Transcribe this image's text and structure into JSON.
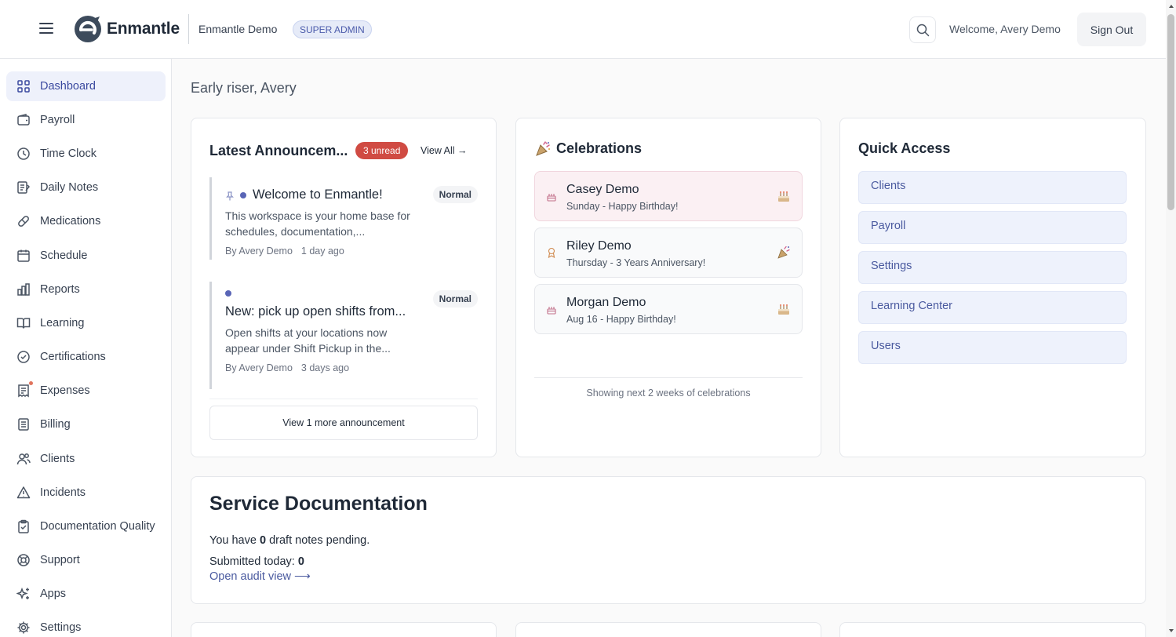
{
  "header": {
    "brand": "Enmantle",
    "org_name": "Enmantle Demo",
    "role_badge": "SUPER ADMIN",
    "welcome": "Welcome, Avery Demo",
    "sign_out": "Sign Out"
  },
  "sidebar": {
    "items": [
      {
        "label": "Dashboard",
        "icon": "grid-icon",
        "active": true
      },
      {
        "label": "Payroll",
        "icon": "wallet-icon"
      },
      {
        "label": "Time Clock",
        "icon": "clock-icon"
      },
      {
        "label": "Daily Notes",
        "icon": "notes-icon"
      },
      {
        "label": "Medications",
        "icon": "pill-icon"
      },
      {
        "label": "Schedule",
        "icon": "calendar-icon"
      },
      {
        "label": "Reports",
        "icon": "bar-chart-icon"
      },
      {
        "label": "Learning",
        "icon": "book-icon"
      },
      {
        "label": "Certifications",
        "icon": "check-circle-icon"
      },
      {
        "label": "Expenses",
        "icon": "receipt-icon"
      },
      {
        "label": "Billing",
        "icon": "document-icon"
      },
      {
        "label": "Clients",
        "icon": "users-icon"
      },
      {
        "label": "Incidents",
        "icon": "alert-icon"
      },
      {
        "label": "Documentation Quality",
        "icon": "clipboard-check-icon"
      },
      {
        "label": "Support",
        "icon": "lifebuoy-icon"
      },
      {
        "label": "Apps",
        "icon": "sparkles-icon"
      },
      {
        "label": "Settings",
        "icon": "gear-icon"
      }
    ]
  },
  "main": {
    "greeting": "Early riser, Avery",
    "announcements": {
      "title": "Latest Announcem...",
      "unread": "3 unread",
      "view_all": "View All →",
      "items": [
        {
          "title": "Welcome to Enmantle!",
          "body": "This workspace is your home base for schedules, documentation,...",
          "author": "By Avery Demo",
          "time": "1 day ago",
          "priority": "Normal"
        },
        {
          "title": "New: pick up open shifts from...",
          "body": "Open shifts at your locations now appear under Shift Pickup in the...",
          "author": "By Avery Demo",
          "time": "3 days ago",
          "priority": "Normal"
        }
      ],
      "more": "View 1 more announcement"
    },
    "celebrations": {
      "title": "Celebrations",
      "items": [
        {
          "name": "Casey Demo",
          "desc": "Sunday - Happy Birthday!",
          "type": "birthday"
        },
        {
          "name": "Riley Demo",
          "desc": "Thursday - 3 Years Anniversary!",
          "type": "anniversary"
        },
        {
          "name": "Morgan Demo",
          "desc": "Aug 16 - Happy Birthday!",
          "type": "birthday"
        }
      ],
      "footer": "Showing next 2 weeks of celebrations"
    },
    "quick_access": {
      "title": "Quick Access",
      "items": [
        "Clients",
        "Payroll",
        "Settings",
        "Learning Center",
        "Users"
      ]
    },
    "service_doc": {
      "title": "Service Documentation",
      "draft_prefix": "You have",
      "draft_count": "0",
      "draft_suffix": "draft notes pending.",
      "submitted_label": "Submitted today:",
      "submitted_count": "0",
      "audit_link": "Open audit view ⟶"
    }
  },
  "colors": {
    "accent": "#3b4aa0",
    "unread_badge": "#d04b43",
    "quick_access_bg": "#eef2fc"
  }
}
